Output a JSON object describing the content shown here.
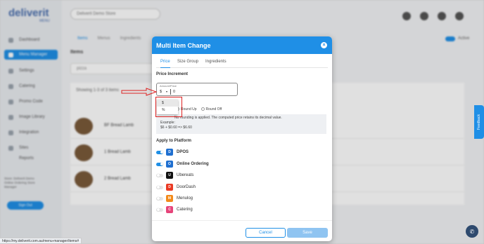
{
  "app": {
    "logo": "deliverit",
    "logo_sub": "MENU",
    "store": "Deliverit Demo Store",
    "sidebar": [
      {
        "label": "Dashboard",
        "icon": "dashboard-icon"
      },
      {
        "label": "Menu Manager",
        "icon": "menu-icon",
        "active": true
      },
      {
        "label": "Settings",
        "icon": "gear-icon"
      },
      {
        "label": "Catering",
        "icon": "catering-icon"
      },
      {
        "label": "Promo Code",
        "icon": "promo-icon"
      },
      {
        "label": "Image Library",
        "icon": "image-icon"
      },
      {
        "label": "Integration",
        "icon": "link-icon"
      },
      {
        "label": "Sites",
        "icon": "sites-icon"
      },
      {
        "label": "Reports",
        "icon": "report-icon"
      }
    ],
    "sidebar_footer": [
      "Store: Deliverit Demo",
      "Online Ordering Store",
      "Manager"
    ],
    "signout_label": "Sign Out",
    "tabs": [
      "Items",
      "Menus",
      "Ingredients"
    ],
    "active_label": "Active",
    "items_title": "Items",
    "search_value": "pizza",
    "showing_text": "Showing 1-3 of 3 items",
    "rows": [
      {
        "name": "BF Bread Lamb"
      },
      {
        "name": "1 Bread Lamb"
      },
      {
        "name": "2 Bread Lamb"
      }
    ],
    "feedback_label": "Feedback",
    "url": "https://my.deliverit.com.au/menu-manager/items#"
  },
  "modal": {
    "title": "Multi Item Change",
    "tabs": [
      "Price",
      "Size Group",
      "Ingredients"
    ],
    "active_tab": "Price",
    "price_increment_title": "Price Increment",
    "amount": {
      "label": "Amount/Price",
      "currency": "$",
      "value": "0"
    },
    "dropdown_options": [
      "$",
      "%"
    ],
    "rounding": {
      "round_up": "Round Up",
      "round_off": "Round Off"
    },
    "info_line1": "No rounding is applied. The computed price retains its decimal value.",
    "info_line2": "Example:",
    "info_line3": "$6 + $0.60 => $6.60",
    "apply_title": "Apply to Platform",
    "platforms": [
      {
        "name": "DPOS",
        "enabled": true,
        "color": "#1f6fd0",
        "glyph": "D"
      },
      {
        "name": "Online Ordering",
        "enabled": true,
        "color": "#1f6fd0",
        "glyph": "O"
      },
      {
        "name": "Ubereats",
        "enabled": false,
        "color": "#111111",
        "glyph": "U"
      },
      {
        "name": "DoorDash",
        "enabled": false,
        "color": "#ea3a24",
        "glyph": "D"
      },
      {
        "name": "Menulog",
        "enabled": false,
        "color": "#f28a1a",
        "glyph": "M"
      },
      {
        "name": "Catering",
        "enabled": false,
        "color": "#e6447a",
        "glyph": "C"
      }
    ],
    "cancel_label": "Cancel",
    "save_label": "Save"
  },
  "colors": {
    "accent": "#1f8fe6",
    "annotation": "#dd2222"
  }
}
